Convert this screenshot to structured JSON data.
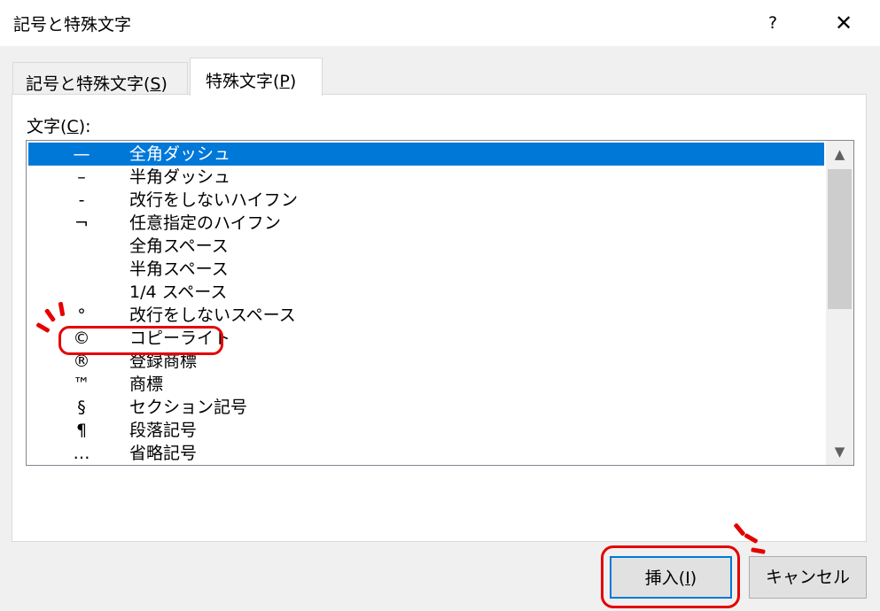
{
  "window": {
    "title": "記号と特殊文字",
    "help": "?",
    "close": "✕"
  },
  "tabs": [
    {
      "pre": "記号と特殊文字(",
      "key": "S",
      "post": ")"
    },
    {
      "pre": "特殊文字(",
      "key": "P",
      "post": ")"
    }
  ],
  "chars_label": {
    "pre": "文字(",
    "key": "C",
    "post": "):"
  },
  "rows": [
    {
      "symbol": "—",
      "name": "全角ダッシュ"
    },
    {
      "symbol": "–",
      "name": "半角ダッシュ"
    },
    {
      "symbol": "-",
      "name": "改行をしないハイフン"
    },
    {
      "symbol": "¬",
      "name": "任意指定のハイフン"
    },
    {
      "symbol": "",
      "name": "全角スペース"
    },
    {
      "symbol": "",
      "name": "半角スペース"
    },
    {
      "symbol": "",
      "name": "1/4 スペース"
    },
    {
      "symbol": "°",
      "name": "改行をしないスペース"
    },
    {
      "symbol": "©",
      "name": "コピーライト"
    },
    {
      "symbol": "®",
      "name": "登録商標"
    },
    {
      "symbol": "™",
      "name": "商標"
    },
    {
      "symbol": "§",
      "name": "セクション記号"
    },
    {
      "symbol": "¶",
      "name": "段落記号"
    },
    {
      "symbol": "…",
      "name": "省略記号"
    }
  ],
  "selected_index": 0,
  "scroll": {
    "up": "▲",
    "down": "▼"
  },
  "buttons": {
    "insert": {
      "pre": "挿入(",
      "key": "I",
      "post": ")"
    },
    "cancel": "キャンセル"
  },
  "colors": {
    "selection": "#0078d7",
    "annotation": "#e50000"
  }
}
